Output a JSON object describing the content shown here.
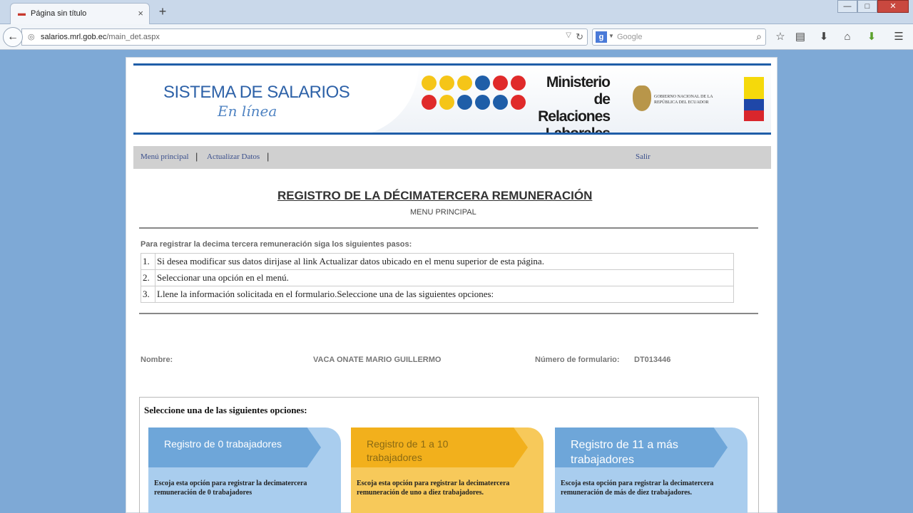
{
  "browser": {
    "tab_title": "Página sin título",
    "tab_close": "×",
    "new_tab": "+",
    "url_domain": "salarios.mrl.gob.ec",
    "url_path": "/main_det.aspx",
    "search_placeholder": "Google",
    "search_engine_letter": "g",
    "window_buttons": {
      "minimize": "—",
      "maximize": "□",
      "close": "✕"
    }
  },
  "header": {
    "system_title": "SISTEMA DE SALARIOS",
    "system_subtitle": "En línea",
    "ministry": [
      "Ministerio",
      "de Relaciones",
      "Laborales"
    ],
    "government_text": "GOBIERNO NACIONAL DE LA REPÚBLICA DEL ECUADOR",
    "dot_colors": [
      "#f5c518",
      "#f5c518",
      "#f5c518",
      "#1f5ea8",
      "#e02a2a",
      "#e02a2a",
      "#e02a2a",
      "#f5c518",
      "#1f5ea8",
      "#1f5ea8",
      "#1f5ea8",
      "#e02a2a"
    ]
  },
  "menu": {
    "items": [
      "Menú principal",
      "Actualizar Datos",
      "Salir"
    ],
    "separator": "|"
  },
  "main": {
    "title": "REGISTRO DE LA DÉCIMATERCERA REMUNERACIÓN",
    "subtitle": "MENU PRINCIPAL",
    "instructions": "Para registrar la decima tercera remuneración siga los siguientes pasos:",
    "steps": [
      {
        "num": "1.",
        "text": "Si desea modificar sus datos dirijase al link Actualizar datos ubicado en el menu superior de esta página."
      },
      {
        "num": "2.",
        "text": "Seleccionar una opción en el menú."
      },
      {
        "num": "3.",
        "text": "Llene la información solicitada en el formulario.Seleccione una de las siguientes opciones:"
      }
    ],
    "name_label": "Nombre:",
    "name_value": "VACA ONATE MARIO GUILLERMO",
    "form_number_label": "Número de formulario:",
    "form_number_value": "DT013446"
  },
  "options": {
    "heading": "Seleccione una de las siguientes opciones:",
    "cards": [
      {
        "title": "Registro de 0 trabajadores",
        "description": "Escoja esta opción para registrar la decimatercera remuneración de 0 trabajadores",
        "color": "#6ea6d9"
      },
      {
        "title": "Registro de 1 a 10 trabajadores",
        "description": "Escoja esta opción para registrar la decimatercera remuneración de uno a diez trabajadores.",
        "color": "#f2b01c"
      },
      {
        "title": "Registro de 11 a más trabajadores",
        "description": "Escoja esta opción para registrar la decimatercera remuneración de más de diez trabajadores.",
        "color": "#6ea6d9"
      }
    ]
  }
}
